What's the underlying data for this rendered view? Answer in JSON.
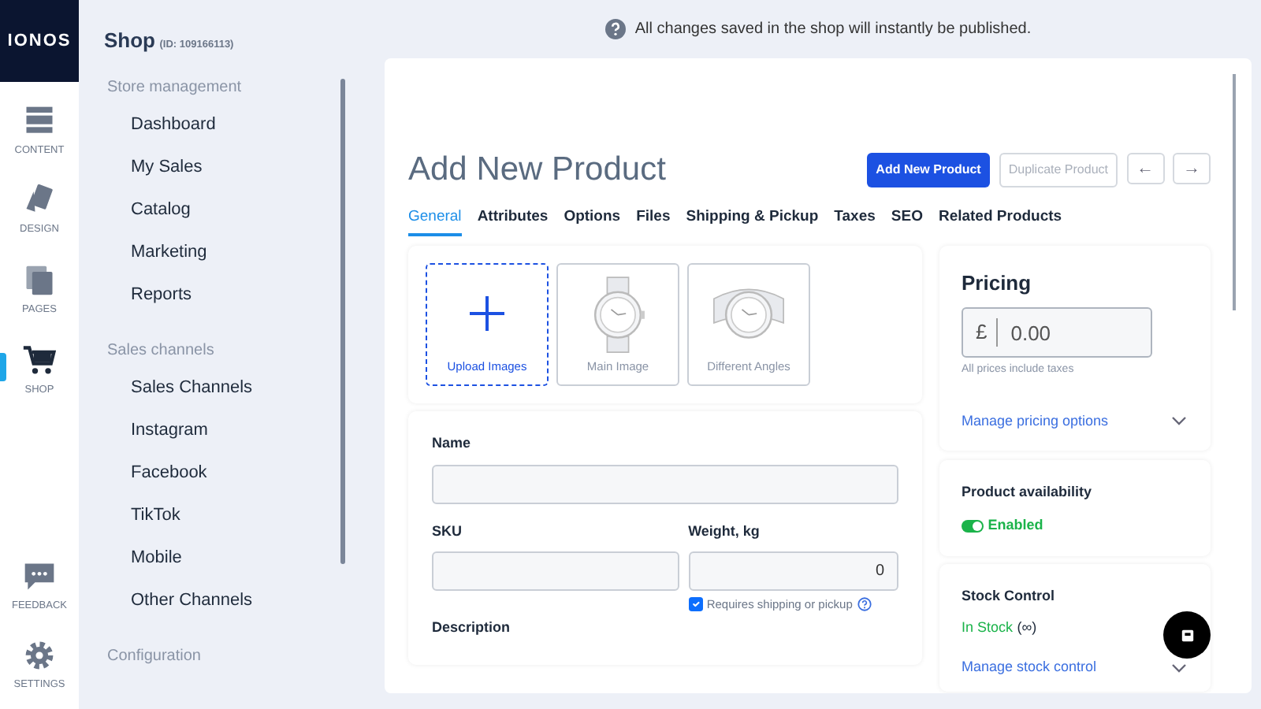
{
  "logo": "IONOS",
  "rail": [
    {
      "kind": "content",
      "label": "CONTENT",
      "selected": false
    },
    {
      "kind": "design",
      "label": "DESIGN",
      "selected": false
    },
    {
      "kind": "pages",
      "label": "PAGES",
      "selected": false
    },
    {
      "kind": "shop",
      "label": "SHOP",
      "selected": true
    },
    {
      "kind": "feedback",
      "label": "FEEDBACK",
      "selected": false
    },
    {
      "kind": "settings",
      "label": "SETTINGS",
      "selected": false
    }
  ],
  "sidebar": {
    "title": "Shop",
    "id": "(ID: 109166113)",
    "sections": [
      {
        "heading": "Store management",
        "items": [
          "Dashboard",
          "My Sales",
          "Catalog",
          "Marketing",
          "Reports"
        ]
      },
      {
        "heading": "Sales channels",
        "items": [
          "Sales Channels",
          "Instagram",
          "Facebook",
          "TikTok",
          "Mobile",
          "Other Channels"
        ]
      },
      {
        "heading": "Configuration"
      }
    ]
  },
  "notice": "All changes saved in the shop will instantly be published.",
  "page_title": "Add New Product",
  "buttons": [
    {
      "kind": "primary",
      "label": "Add New Product",
      "disabled": false
    },
    {
      "kind": "outline",
      "label": "Duplicate Product",
      "disabled": true
    },
    {
      "kind": "prev",
      "label": "←",
      "disabled": false
    },
    {
      "kind": "next",
      "label": "→",
      "disabled": false
    }
  ],
  "tabs": [
    {
      "label": "General",
      "selected": true
    },
    {
      "label": "Attributes",
      "selected": false
    },
    {
      "label": "Options",
      "selected": false
    },
    {
      "label": "Files",
      "selected": false
    },
    {
      "label": "Shipping & Pickup",
      "selected": false
    },
    {
      "label": "Taxes",
      "selected": false
    },
    {
      "label": "SEO",
      "selected": false
    },
    {
      "label": "Related Products",
      "selected": false
    }
  ],
  "images": [
    {
      "kind": "upload",
      "label": "Upload Images"
    },
    {
      "kind": "watch",
      "label": "Main Image"
    },
    {
      "kind": "angle",
      "label": "Different Angles"
    }
  ],
  "form": {
    "name_label": "Name",
    "sku_label": "SKU",
    "weight_label": "Weight, kg",
    "weight_value": "0",
    "shipping": {
      "label": "Requires shipping or pickup",
      "checked": true
    },
    "description_label": "Description"
  },
  "pricing": {
    "title": "Pricing",
    "currency": "£",
    "value": "0.00",
    "note": "All prices include taxes",
    "link": "Manage pricing options"
  },
  "availability": {
    "title": "Product availability",
    "on": true,
    "label": "Enabled"
  },
  "stock": {
    "title": "Stock Control",
    "status": "In Stock",
    "quantity": "(∞)",
    "link": "Manage stock control"
  }
}
